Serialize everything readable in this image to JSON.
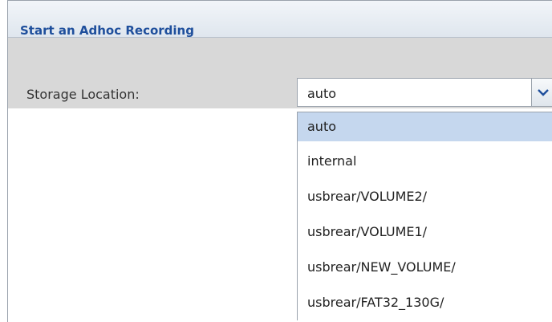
{
  "dialog": {
    "title": "Start an Adhoc Recording"
  },
  "form": {
    "storage_label": "Storage Location:",
    "storage_value": "auto",
    "arrow_icon": "chevron-down-icon",
    "accent_color": "#1f4f9c",
    "selection_color": "#c5d7ee"
  },
  "dropdown": {
    "options": [
      {
        "label": "auto",
        "selected": true
      },
      {
        "label": "internal",
        "selected": false
      },
      {
        "label": "usbrear/VOLUME2/",
        "selected": false
      },
      {
        "label": "usbrear/VOLUME1/",
        "selected": false
      },
      {
        "label": "usbrear/NEW_VOLUME/",
        "selected": false
      },
      {
        "label": "usbrear/FAT32_130G/",
        "selected": false
      }
    ]
  }
}
